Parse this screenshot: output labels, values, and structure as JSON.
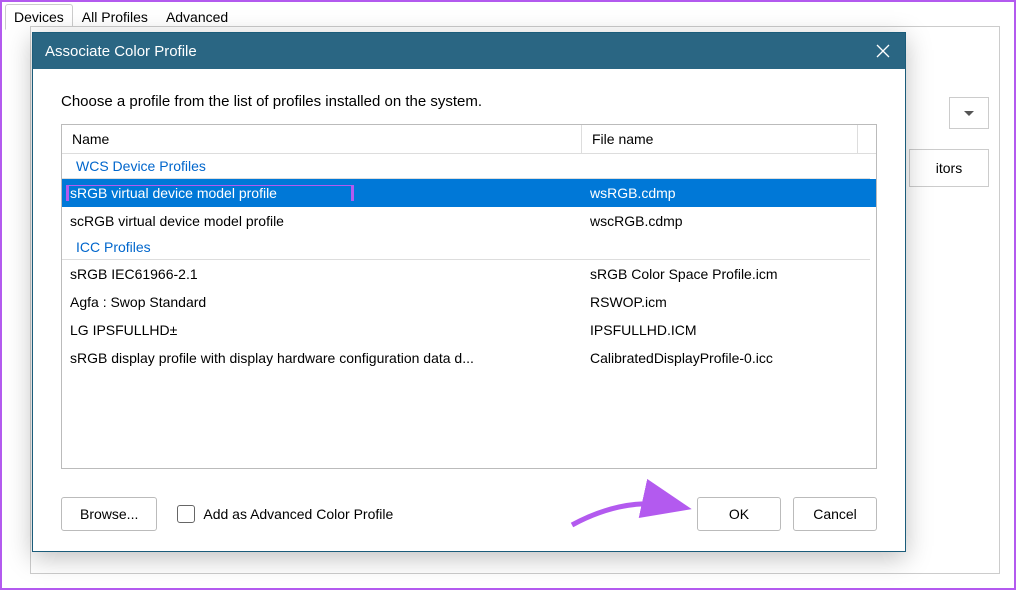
{
  "bg": {
    "tabs": [
      "Devices",
      "All Profiles",
      "Advanced"
    ],
    "button_partial": "itors"
  },
  "dialog": {
    "title": "Associate Color Profile",
    "instruction": "Choose a profile from the list of profiles installed on the system.",
    "columns": {
      "name": "Name",
      "file": "File name"
    },
    "groups": [
      {
        "label": "WCS Device Profiles",
        "rows": [
          {
            "name": "sRGB virtual device model profile",
            "file": "wsRGB.cdmp",
            "selected": true
          },
          {
            "name": "scRGB virtual device model profile",
            "file": "wscRGB.cdmp",
            "selected": false
          }
        ]
      },
      {
        "label": "ICC Profiles",
        "rows": [
          {
            "name": "sRGB IEC61966-2.1",
            "file": "sRGB Color Space Profile.icm",
            "selected": false
          },
          {
            "name": "Agfa : Swop Standard",
            "file": "RSWOP.icm",
            "selected": false
          },
          {
            "name": "LG IPSFULLHD±",
            "file": "IPSFULLHD.ICM",
            "selected": false
          },
          {
            "name": "sRGB display profile with display hardware configuration data d...",
            "file": "CalibratedDisplayProfile-0.icc",
            "selected": false
          }
        ]
      }
    ],
    "buttons": {
      "browse": "Browse...",
      "ok": "OK",
      "cancel": "Cancel"
    },
    "checkbox": "Add as Advanced Color Profile"
  }
}
